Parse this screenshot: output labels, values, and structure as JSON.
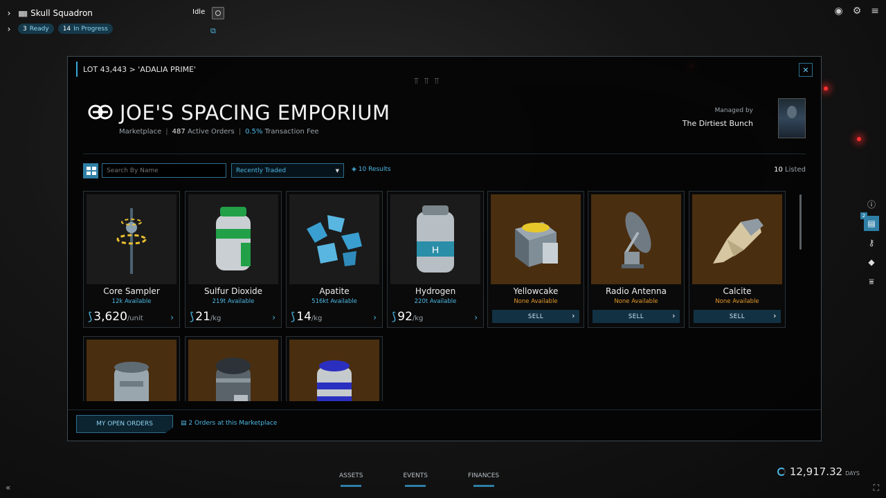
{
  "crew": {
    "name": "Skull Squadron",
    "status": "Idle",
    "ready_count": "3",
    "ready_label": "Ready",
    "progress_count": "14",
    "progress_label": "In Progress"
  },
  "breadcrumb": "LOT 43,443 > 'ADALIA PRIME'",
  "marketplace": {
    "title": "JOE'S SPACING EMPORIUM",
    "type": "Marketplace",
    "active_orders": "487",
    "active_orders_label": "Active Orders",
    "fee": "0.5%",
    "fee_label": "Transaction Fee",
    "managed_by_label": "Managed by",
    "manager": "The Dirtiest Bunch"
  },
  "toolbar": {
    "search_placeholder": "Search By Name",
    "sort_value": "Recently Traded",
    "results": "10 Results",
    "listed_count": "10",
    "listed_label": "Listed"
  },
  "products": [
    {
      "name": "Core Sampler",
      "available": "12k Available",
      "price": "3,620",
      "unit": "/unit",
      "mode": "buy",
      "icon": "core-sampler-icon"
    },
    {
      "name": "Sulfur Dioxide",
      "available": "219t Available",
      "price": "21",
      "unit": "/kg",
      "mode": "buy",
      "icon": "canister-green-icon"
    },
    {
      "name": "Apatite",
      "available": "516kt Available",
      "price": "14",
      "unit": "/kg",
      "mode": "buy",
      "icon": "crystals-icon"
    },
    {
      "name": "Hydrogen",
      "available": "220t Available",
      "price": "92",
      "unit": "/kg",
      "mode": "buy",
      "icon": "canister-hydrogen-icon"
    },
    {
      "name": "Yellowcake",
      "available": "None Available",
      "action": "SELL",
      "mode": "sell",
      "icon": "yellowcake-icon"
    },
    {
      "name": "Radio Antenna",
      "available": "None Available",
      "action": "SELL",
      "mode": "sell",
      "icon": "antenna-icon"
    },
    {
      "name": "Calcite",
      "available": "None Available",
      "action": "SELL",
      "mode": "sell",
      "icon": "calcite-icon"
    },
    {
      "mode": "sell",
      "icon": "canister-grey-icon"
    },
    {
      "mode": "sell",
      "icon": "canister-dark-icon"
    },
    {
      "mode": "sell",
      "icon": "canister-blue-icon"
    }
  ],
  "footer": {
    "orders_button": "MY OPEN ORDERS",
    "orders_link": "2 Orders at this Marketplace"
  },
  "side_badge": "2",
  "bottom_nav": [
    "ASSETS",
    "EVENTS",
    "FINANCES"
  ],
  "clock": {
    "value": "12,917.32",
    "unit": "DAYS"
  },
  "colors": {
    "accent": "#4db8e6",
    "sell_bg": "#4a2e10",
    "unavailable": "#e59a2c"
  }
}
